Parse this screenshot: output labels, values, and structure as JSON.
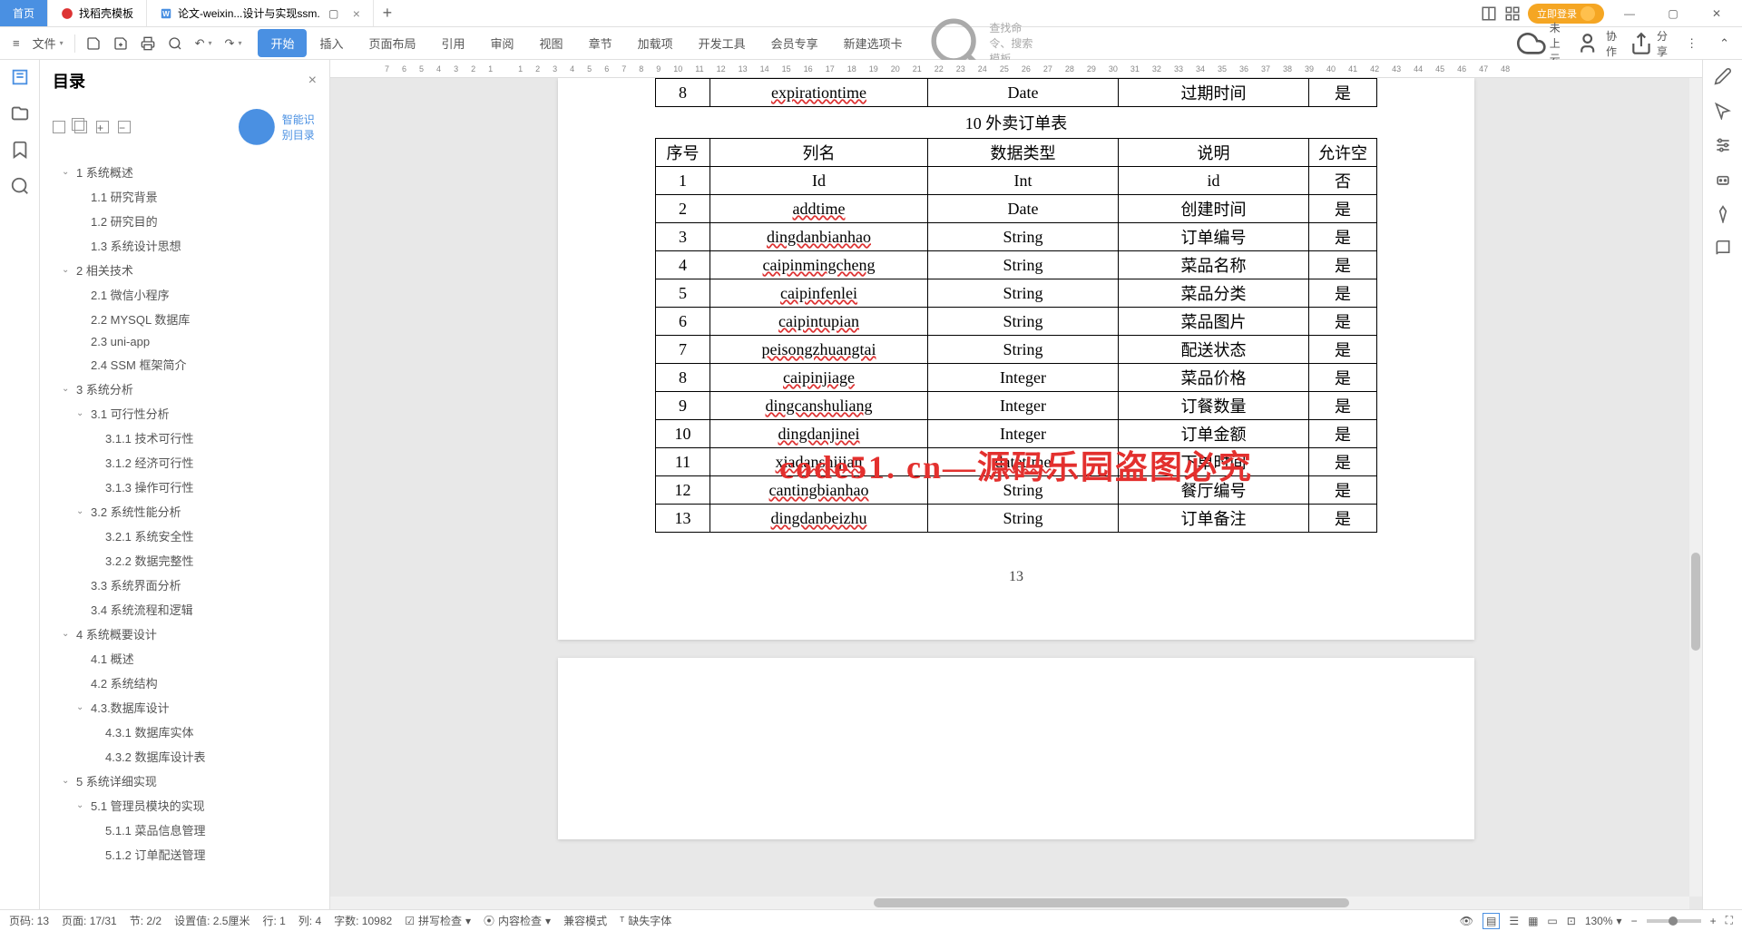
{
  "titlebar": {
    "tabs": [
      {
        "label": "首页",
        "type": "home"
      },
      {
        "label": "找稻壳模板",
        "icon": "docer"
      },
      {
        "label": "论文-weixin...设计与实现ssm.",
        "icon": "word",
        "active": true
      }
    ],
    "login": "立即登录"
  },
  "toolbar": {
    "file": "文件",
    "ribbons": [
      "开始",
      "插入",
      "页面布局",
      "引用",
      "审阅",
      "视图",
      "章节",
      "加载项",
      "开发工具",
      "会员专享",
      "新建选项卡"
    ],
    "active_ribbon": 0,
    "search_placeholder": "查找命令、搜索模板",
    "right": {
      "cloud": "未上云",
      "collab": "协作",
      "share": "分享"
    }
  },
  "outline": {
    "title": "目录",
    "smart": "智能识别目录",
    "items": [
      {
        "level": 1,
        "text": "1 系统概述",
        "expand": true
      },
      {
        "level": 2,
        "text": "1.1 研究背景"
      },
      {
        "level": 2,
        "text": "1.2 研究目的"
      },
      {
        "level": 2,
        "text": "1.3 系统设计思想"
      },
      {
        "level": 1,
        "text": "2 相关技术",
        "expand": true
      },
      {
        "level": 2,
        "text": "2.1 微信小程序"
      },
      {
        "level": 2,
        "text": "2.2 MYSQL 数据库"
      },
      {
        "level": 2,
        "text": "2.3 uni-app"
      },
      {
        "level": 2,
        "text": "2.4 SSM 框架简介"
      },
      {
        "level": 1,
        "text": "3 系统分析",
        "expand": true
      },
      {
        "level": 2,
        "text": "3.1 可行性分析",
        "expand": true
      },
      {
        "level": 3,
        "text": "3.1.1 技术可行性"
      },
      {
        "level": 3,
        "text": "3.1.2 经济可行性"
      },
      {
        "level": 3,
        "text": "3.1.3 操作可行性"
      },
      {
        "level": 2,
        "text": "3.2 系统性能分析",
        "expand": true
      },
      {
        "level": 3,
        "text": "3.2.1 系统安全性"
      },
      {
        "level": 3,
        "text": "3.2.2 数据完整性"
      },
      {
        "level": 2,
        "text": "3.3 系统界面分析"
      },
      {
        "level": 2,
        "text": "3.4 系统流程和逻辑"
      },
      {
        "level": 1,
        "text": "4 系统概要设计",
        "expand": true
      },
      {
        "level": 2,
        "text": "4.1 概述"
      },
      {
        "level": 2,
        "text": "4.2 系统结构"
      },
      {
        "level": 2,
        "text": "4.3.数据库设计",
        "expand": true
      },
      {
        "level": 3,
        "text": "4.3.1 数据库实体"
      },
      {
        "level": 3,
        "text": "4.3.2 数据库设计表"
      },
      {
        "level": 1,
        "text": "5 系统详细实现",
        "expand": true
      },
      {
        "level": 2,
        "text": "5.1 管理员模块的实现",
        "expand": true
      },
      {
        "level": 3,
        "text": "5.1.1 菜品信息管理"
      },
      {
        "level": 3,
        "text": "5.1.2 订单配送管理"
      }
    ]
  },
  "document": {
    "prev_table_last_row": [
      "8",
      "expirationtime",
      "Date",
      "过期时间",
      "是"
    ],
    "table_caption": "10 外卖订单表",
    "headers": [
      "序号",
      "列名",
      "数据类型",
      "说明",
      "允许空"
    ],
    "rows": [
      [
        "1",
        "Id",
        "Int",
        "id",
        "否"
      ],
      [
        "2",
        "addtime",
        "Date",
        "创建时间",
        "是"
      ],
      [
        "3",
        "dingdanbianhao",
        "String",
        "订单编号",
        "是"
      ],
      [
        "4",
        "caipinmingcheng",
        "String",
        "菜品名称",
        "是"
      ],
      [
        "5",
        "caipinfenlei",
        "String",
        "菜品分类",
        "是"
      ],
      [
        "6",
        "caipintupian",
        "String",
        "菜品图片",
        "是"
      ],
      [
        "7",
        "peisongzhuangtai",
        "String",
        "配送状态",
        "是"
      ],
      [
        "8",
        "caipinjiage",
        "Integer",
        "菜品价格",
        "是"
      ],
      [
        "9",
        "dingcanshuliang",
        "Integer",
        "订餐数量",
        "是"
      ],
      [
        "10",
        "dingdanjinei",
        "Integer",
        "订单金额",
        "是"
      ],
      [
        "11",
        "xiadanshijian",
        "datetime",
        "下单时间",
        "是"
      ],
      [
        "12",
        "cantingbianhao",
        "String",
        "餐厅编号",
        "是"
      ],
      [
        "13",
        "dingdanbeizhu",
        "String",
        "订单备注",
        "是"
      ]
    ],
    "page_number": "13",
    "watermark": "code51. cn—源码乐园盗图必究"
  },
  "ruler_marks": [
    "7",
    "6",
    "5",
    "4",
    "3",
    "2",
    "1",
    "",
    "1",
    "2",
    "3",
    "4",
    "5",
    "6",
    "7",
    "8",
    "9",
    "10",
    "11",
    "12",
    "13",
    "14",
    "15",
    "16",
    "17",
    "18",
    "19",
    "20",
    "21",
    "22",
    "23",
    "24",
    "25",
    "26",
    "27",
    "28",
    "29",
    "30",
    "31",
    "32",
    "33",
    "34",
    "35",
    "36",
    "37",
    "38",
    "39",
    "40",
    "41",
    "42",
    "43",
    "44",
    "45",
    "46",
    "47",
    "48"
  ],
  "statusbar": {
    "page": "页码: 13",
    "pages": "页面: 17/31",
    "section": "节: 2/2",
    "setting": "设置值: 2.5厘米",
    "line": "行: 1",
    "col": "列: 4",
    "words": "字数: 10982",
    "spell": "拼写检查",
    "content": "内容检查",
    "compat": "兼容模式",
    "font": "缺失字体",
    "zoom": "130%"
  }
}
